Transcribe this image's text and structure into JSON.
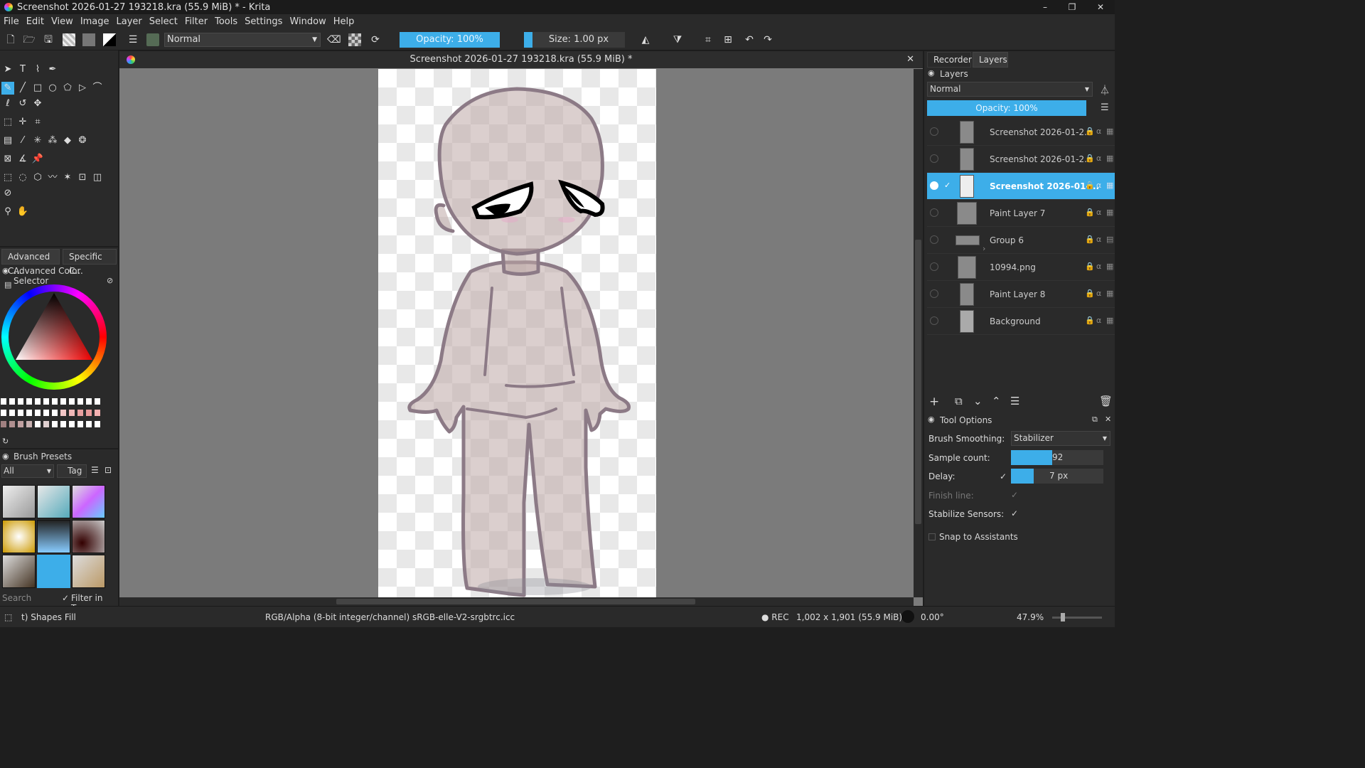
{
  "window": {
    "title": "Screenshot 2026-01-27 193218.kra (55.9 MiB) * - Krita",
    "minimize": "–",
    "restore": "❐",
    "close": "✕"
  },
  "menu": [
    "File",
    "Edit",
    "View",
    "Image",
    "Layer",
    "Select",
    "Filter",
    "Tools",
    "Settings",
    "Window",
    "Help"
  ],
  "toolbar": {
    "blend_mode": "Normal",
    "opacity": "Opacity: 100%",
    "size": "Size: 1.00 px"
  },
  "document": {
    "tab_title": "Screenshot 2026-01-27 193218.kra (55.9 MiB) *",
    "close": "✕"
  },
  "color_panel": {
    "tabs": [
      "Advanced C...",
      "Specific C..."
    ],
    "title": "Advanced Color Selector"
  },
  "brush_presets": {
    "title": "Brush Presets",
    "filter": "All",
    "tag": "Tag",
    "search_placeholder": "Search",
    "filter_in_tag": "Filter in Tag"
  },
  "right_tabs": [
    "Recorder",
    "Layers"
  ],
  "layers_panel": {
    "title": "Layers",
    "blend_mode": "Normal",
    "opacity": "Opacity:  100%"
  },
  "layers": [
    {
      "name": "Screenshot 2026-01-2...",
      "selected": false
    },
    {
      "name": "Screenshot 2026-01-2...",
      "selected": false
    },
    {
      "name": "Screenshot 2026-01-...",
      "selected": true
    },
    {
      "name": "Paint Layer 7",
      "selected": false
    },
    {
      "name": "Group 6",
      "selected": false
    },
    {
      "name": "10994.png",
      "selected": false
    },
    {
      "name": "Paint Layer 8",
      "selected": false
    },
    {
      "name": "Background",
      "selected": false
    }
  ],
  "tool_options": {
    "title": "Tool Options",
    "smoothing_label": "Brush Smoothing:",
    "smoothing_value": "Stabilizer",
    "sample_label": "Sample count:",
    "sample_value": "92",
    "delay_label": "Delay:",
    "delay_value": "7 px",
    "finish_label": "Finish line:",
    "sensors_label": "Stabilize Sensors:",
    "snap_label": "Snap to Assistants"
  },
  "status": {
    "tool": "t) Shapes Fill",
    "colorspace": "RGB/Alpha (8-bit integer/channel)  sRGB-elle-V2-srgbtrc.icc",
    "rec": "● REC",
    "dims": "1,002 x 1,901 (55.9 MiB)",
    "rotation": "0.00°",
    "zoom": "47.9%"
  },
  "colors": {
    "accent": "#3daee9",
    "panel": "#2a2a2a",
    "canvas_bg": "#7b7b7b",
    "body_fill": "#d9c9c7",
    "outline": "#8c7a86"
  }
}
